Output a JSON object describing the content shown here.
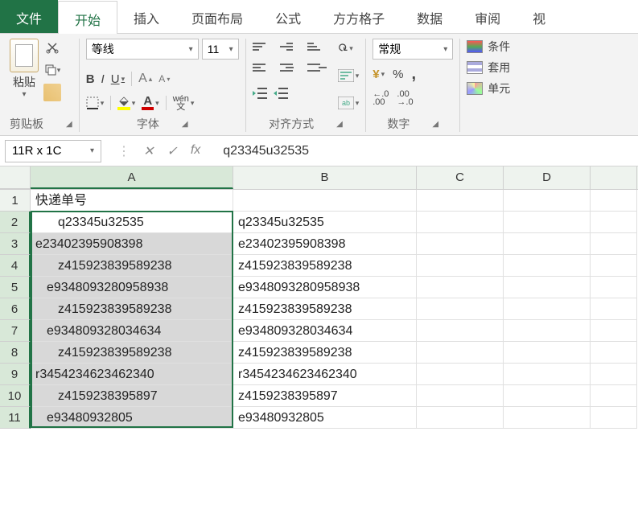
{
  "tabs": {
    "file": "文件",
    "home": "开始",
    "insert": "插入",
    "layout": "页面布局",
    "formulas": "公式",
    "ffgz": "方方格子",
    "data": "数据",
    "review": "审阅",
    "view": "视"
  },
  "ribbon": {
    "clipboard": {
      "paste": "粘贴",
      "label": "剪贴板"
    },
    "font": {
      "name": "等线",
      "size": "11",
      "bold": "B",
      "italic": "I",
      "underline": "U",
      "grow": "A",
      "shrink": "A",
      "fill": "◆",
      "color": "A",
      "ruby_top": "wén",
      "ruby_bot": "文",
      "label": "字体"
    },
    "align": {
      "label": "对齐方式",
      "ab": "ab"
    },
    "number": {
      "format": "常规",
      "currency": "¥",
      "percent": "%",
      "comma": ",",
      "inc": "←.0\n.00",
      "dec": ".00\n→.0",
      "label": "数字"
    },
    "styles": {
      "cond": "条件",
      "table": "套用",
      "cell": "单元"
    }
  },
  "fbar": {
    "name": "11R x 1C",
    "cancel": "✕",
    "ok": "✓",
    "fx": "fx",
    "value": "q23345u32535"
  },
  "sheet": {
    "cols": [
      "A",
      "B",
      "C",
      "D"
    ],
    "header_row": {
      "A": "快递单号"
    },
    "rows": [
      {
        "n": 2,
        "A": "q23345u32535",
        "B": "q23345u32535"
      },
      {
        "n": 3,
        "A": "e23402395908398",
        "B": "e23402395908398"
      },
      {
        "n": 4,
        "A": "z415923839589238",
        "B": "z415923839589238"
      },
      {
        "n": 5,
        "A": "e9348093280958938",
        "B": "e9348093280958938"
      },
      {
        "n": 6,
        "A": "z415923839589238",
        "B": "z415923839589238"
      },
      {
        "n": 7,
        "A": "e934809328034634",
        "B": "e934809328034634"
      },
      {
        "n": 8,
        "A": "z415923839589238",
        "B": "z415923839589238"
      },
      {
        "n": 9,
        "A": "r3454234623462340",
        "B": "r3454234623462340"
      },
      {
        "n": 10,
        "A": "z4159238395897",
        "B": "z4159238395897"
      },
      {
        "n": 11,
        "A": "e93480932805",
        "B": "e93480932805"
      }
    ],
    "indent": {
      "2": 2,
      "4": 2,
      "5": 1,
      "6": 2,
      "7": 1,
      "8": 2,
      "10": 2,
      "11": 1
    }
  }
}
